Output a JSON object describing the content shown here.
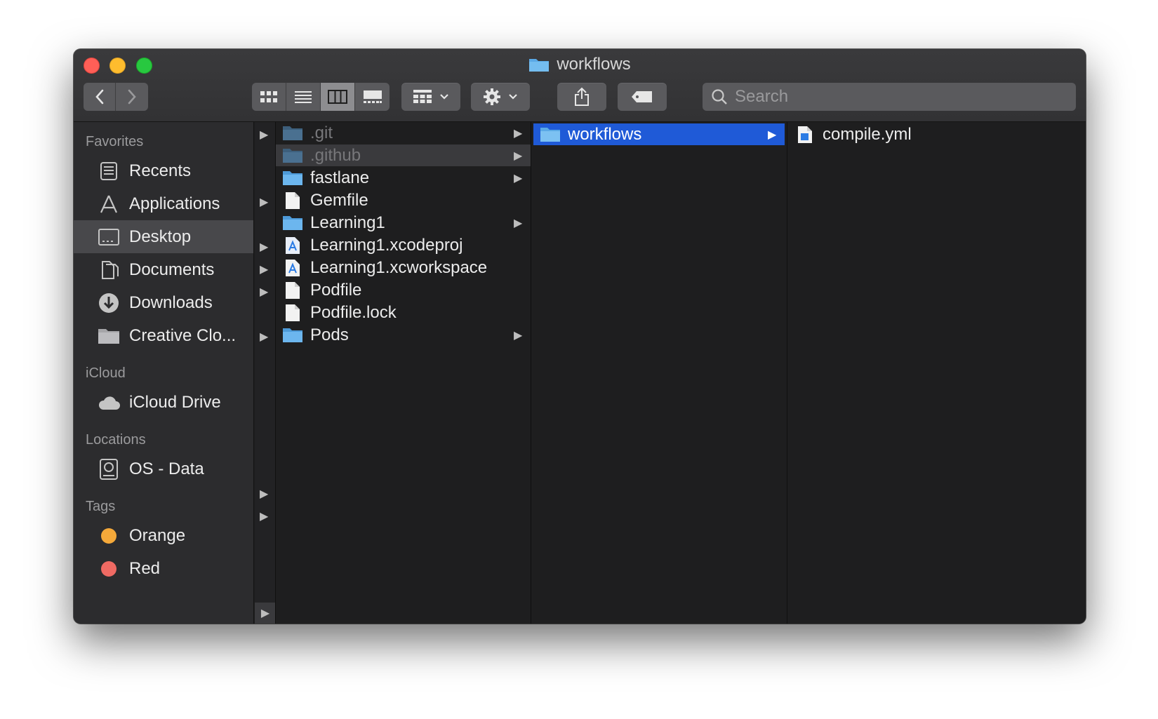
{
  "window": {
    "title": "workflows"
  },
  "toolbar": {
    "back_icon": "chevron-left-icon",
    "forward_icon": "chevron-right-icon",
    "view_modes": [
      "icon-view",
      "list-view",
      "column-view",
      "gallery-view"
    ],
    "active_view": "column-view",
    "search_placeholder": "Search"
  },
  "sidebar": {
    "sections": [
      {
        "title": "Favorites",
        "items": [
          {
            "label": "Recents",
            "icon": "recents-icon"
          },
          {
            "label": "Applications",
            "icon": "applications-icon"
          },
          {
            "label": "Desktop",
            "icon": "desktop-icon",
            "selected": true
          },
          {
            "label": "Documents",
            "icon": "documents-icon"
          },
          {
            "label": "Downloads",
            "icon": "downloads-icon"
          },
          {
            "label": "Creative Clo...",
            "icon": "folder-icon"
          }
        ]
      },
      {
        "title": "iCloud",
        "items": [
          {
            "label": "iCloud Drive",
            "icon": "cloud-icon"
          }
        ]
      },
      {
        "title": "Locations",
        "items": [
          {
            "label": "OS - Data",
            "icon": "disk-icon"
          }
        ]
      },
      {
        "title": "Tags",
        "items": [
          {
            "label": "Orange",
            "color": "#f5a93a"
          },
          {
            "label": "Red",
            "color": "#ef6a63"
          }
        ]
      }
    ]
  },
  "columns": {
    "project": [
      {
        "name": ".git",
        "kind": "folder",
        "dim": true,
        "has_children": true
      },
      {
        "name": ".github",
        "kind": "folder",
        "dim": true,
        "has_children": true,
        "selected": true
      },
      {
        "name": "fastlane",
        "kind": "folder",
        "has_children": true
      },
      {
        "name": "Gemfile",
        "kind": "file"
      },
      {
        "name": "Learning1",
        "kind": "folder",
        "has_children": true
      },
      {
        "name": "Learning1.xcodeproj",
        "kind": "xcode"
      },
      {
        "name": "Learning1.xcworkspace",
        "kind": "xcode"
      },
      {
        "name": "Podfile",
        "kind": "file"
      },
      {
        "name": "Podfile.lock",
        "kind": "file"
      },
      {
        "name": "Pods",
        "kind": "folder",
        "has_children": true
      }
    ],
    "github": [
      {
        "name": "workflows",
        "kind": "folder",
        "has_children": true,
        "selected": true
      }
    ],
    "workflows": [
      {
        "name": "compile.yml",
        "kind": "yml"
      }
    ]
  },
  "colors": {
    "window_bg": "#1e1e1f",
    "sidebar_bg": "#2c2c2e",
    "selection_blue": "#1f5ad7",
    "folder_blue": "#5aa9e6"
  }
}
